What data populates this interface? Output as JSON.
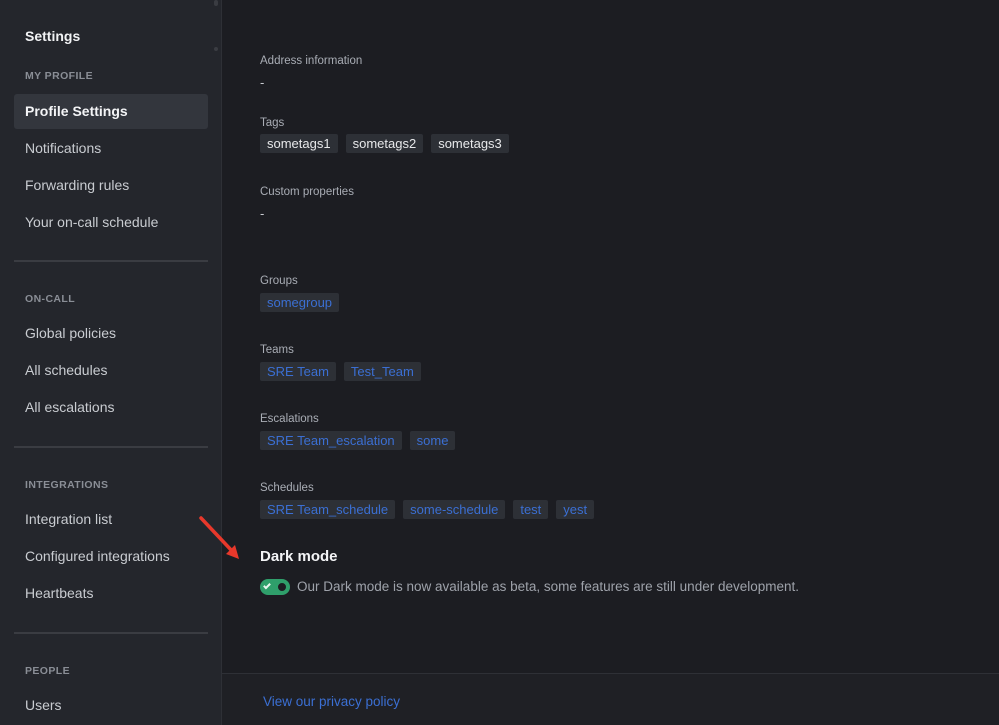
{
  "sidebar": {
    "title": "Settings",
    "sections": [
      {
        "label": "MY PROFILE",
        "items": [
          "Profile Settings",
          "Notifications",
          "Forwarding rules",
          "Your on-call schedule"
        ]
      },
      {
        "label": "ON-CALL",
        "items": [
          "Global policies",
          "All schedules",
          "All escalations"
        ]
      },
      {
        "label": "INTEGRATIONS",
        "items": [
          "Integration list",
          "Configured integrations",
          "Heartbeats"
        ]
      },
      {
        "label": "PEOPLE",
        "items": [
          "Users"
        ]
      }
    ],
    "active_item": "Profile Settings"
  },
  "profile": {
    "address_label": "Address information",
    "address_value": "-",
    "tags_label": "Tags",
    "tags": [
      "sometags1",
      "sometags2",
      "sometags3"
    ],
    "custom_label": "Custom properties",
    "custom_value": "-",
    "groups_label": "Groups",
    "groups": [
      "somegroup"
    ],
    "teams_label": "Teams",
    "teams": [
      "SRE Team",
      "Test_Team"
    ],
    "escalations_label": "Escalations",
    "escalations": [
      "SRE Team_escalation",
      "some"
    ],
    "schedules_label": "Schedules",
    "schedules": [
      "SRE Team_schedule",
      "some-schedule",
      "test",
      "yest"
    ]
  },
  "dark_mode": {
    "heading": "Dark mode",
    "enabled": true,
    "description": "Our Dark mode is now available as beta, some features are still under development."
  },
  "footer": {
    "privacy_link": "View our privacy policy"
  },
  "colors": {
    "accent_link": "#3b6fd3",
    "toggle_on": "#2f9f6b",
    "annotation_arrow": "#e8382b"
  }
}
